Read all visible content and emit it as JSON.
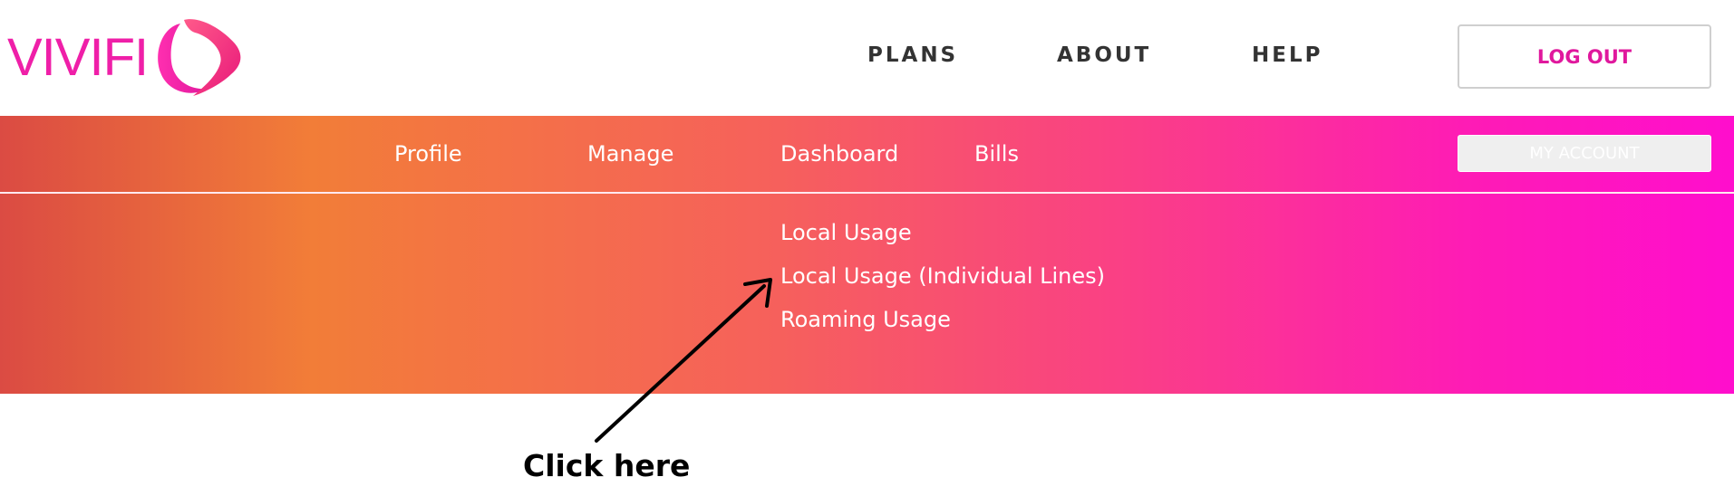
{
  "brand": {
    "name": "VIVIFI",
    "color": "#ef1fa8",
    "mark_icon": "vivifi-swirl-logo-icon"
  },
  "main_nav": {
    "items": [
      {
        "label": "PLANS"
      },
      {
        "label": "ABOUT"
      },
      {
        "label": "HELP"
      }
    ],
    "logout_label": "LOG OUT",
    "logout_color": "#e0189d"
  },
  "sub_nav": {
    "items": [
      {
        "label": "Profile"
      },
      {
        "label": "Manage"
      },
      {
        "label": "Dashboard"
      },
      {
        "label": "Bills"
      }
    ],
    "my_account_label": "MY ACCOUNT",
    "gradient_colors": [
      "#db4b43",
      "#f27d38",
      "#f6605c",
      "#fa3f86",
      "#fe1bb6",
      "#ff0ecd"
    ]
  },
  "dashboard_menu": {
    "items": [
      {
        "label": "Local Usage"
      },
      {
        "label": "Local Usage (Individual Lines)"
      },
      {
        "label": "Roaming Usage"
      }
    ]
  },
  "annotation": {
    "label": "Click here",
    "icon": "arrow-pointer-icon"
  }
}
